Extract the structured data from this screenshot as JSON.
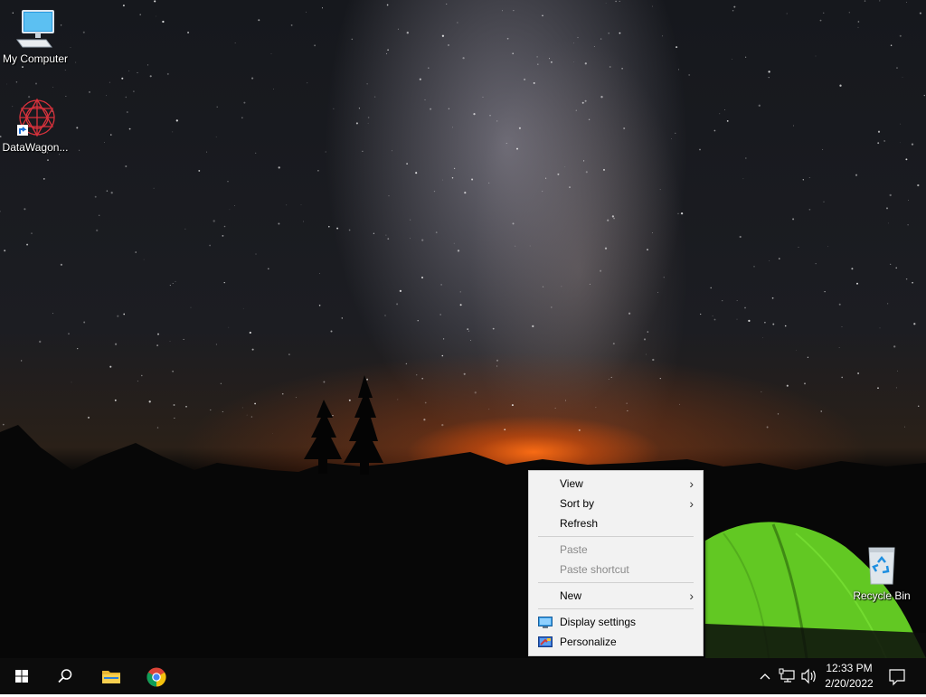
{
  "desktop": {
    "icons": [
      {
        "label": "My Computer",
        "icon": "computer-icon"
      },
      {
        "label": "DataWagon...",
        "icon": "datawagon-app-icon"
      },
      {
        "label": "Recycle Bin",
        "icon": "recycle-bin-icon"
      }
    ]
  },
  "context_menu": {
    "items": [
      {
        "label": "View",
        "submenu": true,
        "enabled": true
      },
      {
        "label": "Sort by",
        "submenu": true,
        "enabled": true
      },
      {
        "label": "Refresh",
        "submenu": false,
        "enabled": true
      },
      {
        "label": "Paste",
        "submenu": false,
        "enabled": false
      },
      {
        "label": "Paste shortcut",
        "submenu": false,
        "enabled": false
      },
      {
        "label": "New",
        "submenu": true,
        "enabled": true
      },
      {
        "label": "Display settings",
        "icon": "display-settings-icon",
        "enabled": true
      },
      {
        "label": "Personalize",
        "icon": "personalize-icon",
        "enabled": true
      }
    ]
  },
  "taskbar": {
    "buttons": [
      {
        "name": "start-button",
        "icon": "windows-logo-icon"
      },
      {
        "name": "search-button",
        "icon": "search-icon"
      },
      {
        "name": "file-explorer-button",
        "icon": "folder-icon"
      },
      {
        "name": "chrome-button",
        "icon": "chrome-icon"
      }
    ],
    "tray": {
      "icons": [
        "chevron-up-icon",
        "network-icon",
        "volume-icon"
      ],
      "time": "12:33 PM",
      "date": "2/20/2022",
      "notification_icon": "notification-icon"
    }
  },
  "colors": {
    "taskbar_bg": "#0c0c0c",
    "menu_bg": "#f2f2f2",
    "disabled_text": "#8a8a8a",
    "tent_green": "#6fd42a"
  }
}
